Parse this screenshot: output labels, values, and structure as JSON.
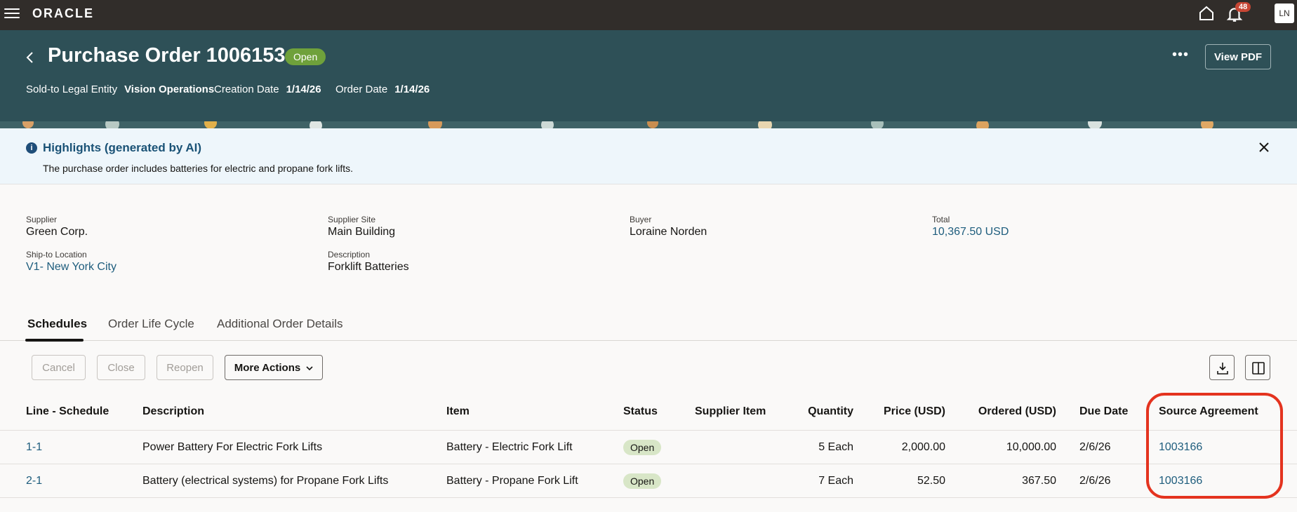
{
  "app": {
    "logo": "ORACLE",
    "notifications": "48",
    "user_initials": "LN"
  },
  "header": {
    "title": "Purchase Order 1006153",
    "status": "Open",
    "sold_to_label": "Sold-to Legal Entity",
    "sold_to_value": "Vision Operations",
    "creation_date_label": "Creation Date",
    "creation_date_value": "1/14/26",
    "order_date_label": "Order Date",
    "order_date_value": "1/14/26",
    "view_pdf": "View PDF"
  },
  "highlights": {
    "title": "Highlights (generated by AI)",
    "text": "The purchase order includes batteries for electric and propane fork lifts."
  },
  "details": {
    "supplier_label": "Supplier",
    "supplier": "Green Corp.",
    "supplier_site_label": "Supplier Site",
    "supplier_site": "Main Building",
    "buyer_label": "Buyer",
    "buyer": "Loraine Norden",
    "total_label": "Total",
    "total": "10,367.50 USD",
    "ship_to_label": "Ship-to Location",
    "ship_to": "V1- New York City",
    "description_label": "Description",
    "description": "Forklift Batteries"
  },
  "tabs": [
    "Schedules",
    "Order Life Cycle",
    "Additional Order Details"
  ],
  "toolbar": {
    "cancel": "Cancel",
    "close": "Close",
    "reopen": "Reopen",
    "more_actions": "More Actions"
  },
  "table": {
    "headers": [
      "Line - Schedule",
      "Description",
      "Item",
      "Status",
      "Supplier Item",
      "Quantity",
      "Price (USD)",
      "Ordered (USD)",
      "Due Date",
      "Source Agreement"
    ],
    "rows": [
      {
        "line": "1-1",
        "description": "Power Battery For Electric Fork Lifts",
        "item": "Battery - Electric Fork Lift",
        "status": "Open",
        "supplier_item": "",
        "quantity": "5 Each",
        "price": "2,000.00",
        "ordered": "10,000.00",
        "due_date": "2/6/26",
        "source_agreement": "1003166"
      },
      {
        "line": "2-1",
        "description": "Battery (electrical systems) for Propane Fork Lifts",
        "item": "Battery - Propane Fork Lift",
        "status": "Open",
        "supplier_item": "",
        "quantity": "7 Each",
        "price": "52.50",
        "ordered": "367.50",
        "due_date": "2/6/26",
        "source_agreement": "1003166"
      }
    ]
  },
  "colors": {
    "header_bg": "#2e5057",
    "topbar_bg": "#312d2a",
    "accent_link": "#1e5d7d",
    "open_badge": "#6fa13b",
    "annotation": "#e4331f"
  }
}
